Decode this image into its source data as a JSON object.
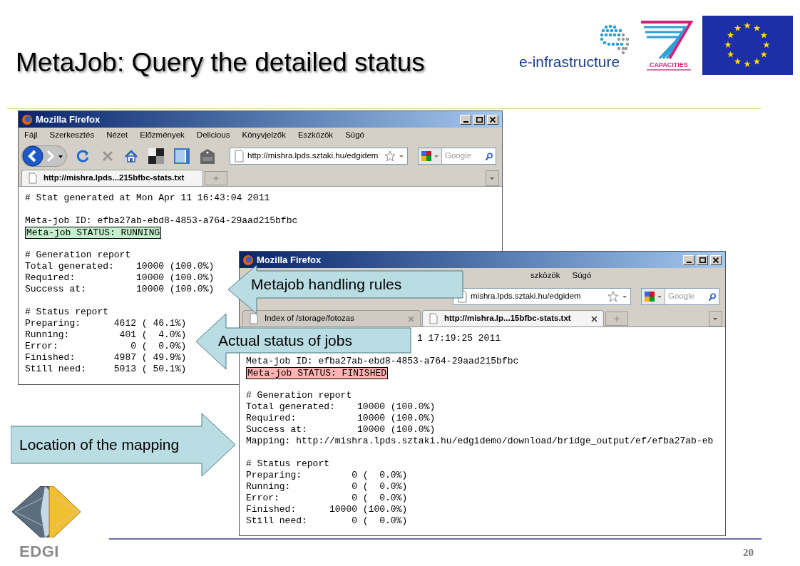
{
  "slide": {
    "title": "MetaJob: Query the detailed status",
    "page_number": "20"
  },
  "logos": {
    "einfra": "e-infrastructure",
    "fp7": "CAPACITIES",
    "edgi": "EDGI"
  },
  "windows": [
    {
      "title": "Mozilla Firefox",
      "toolbar_buttons": true,
      "menu": [
        "Fájl",
        "Szerkesztés",
        "Nézet",
        "Előzmények",
        "Delicious",
        "Könyvjelzők",
        "Eszközök",
        "Súgó"
      ],
      "url": "http://mishra.lpds.sztaki.hu/edgidem",
      "search_placeholder": "Google",
      "tabs": [
        {
          "label": "http://mishra.lpds...215bfbc-stats.txt",
          "selected": true,
          "close_button": false
        }
      ],
      "lines": [
        {
          "kind": "text",
          "text": "# Stat generated at Mon Apr 11 16:43:04 2011"
        },
        {
          "kind": "gap"
        },
        {
          "kind": "text",
          "text": "Meta-job ID: efba27ab-ebd8-4853-a764-29aad215bfbc"
        },
        {
          "kind": "status",
          "text": "Meta-job STATUS: RUNNING",
          "color": "#c6efce"
        },
        {
          "kind": "gap"
        },
        {
          "kind": "text",
          "text": "# Generation report"
        },
        {
          "kind": "text",
          "text": "Total generated:    10000 (100.0%)"
        },
        {
          "kind": "text",
          "text": "Required:           10000 (100.0%)"
        },
        {
          "kind": "text",
          "text": "Success at:         10000 (100.0%)"
        },
        {
          "kind": "gap"
        },
        {
          "kind": "text",
          "text": "# Status report"
        },
        {
          "kind": "text",
          "text": "Preparing:      4612 ( 46.1%)"
        },
        {
          "kind": "text",
          "text": "Running:         401 (  4.0%)"
        },
        {
          "kind": "text",
          "text": "Error:             0 (  0.0%)"
        },
        {
          "kind": "text",
          "text": "Finished:       4987 ( 49.9%)"
        },
        {
          "kind": "text",
          "text": "Still need:     5013 ( 50.1%)"
        }
      ]
    },
    {
      "title": "Mozilla Firefox",
      "toolbar_buttons": false,
      "menu": [
        "szközök",
        "Súgó"
      ],
      "url": "mishra.lpds.sztaki.hu/edgidem",
      "search_placeholder": "Google",
      "tabs": [
        {
          "label": "Index of /storage/fotozas",
          "selected": false,
          "close_button": true
        },
        {
          "label": "http://mishra.lp...15bfbc-stats.txt",
          "selected": true,
          "close_button": true
        }
      ],
      "lines": [
        {
          "kind": "cut",
          "text": "1 17:19:25 2011"
        },
        {
          "kind": "gap"
        },
        {
          "kind": "text",
          "text": "Meta-job ID: efba27ab-ebd8-4853-a764-29aad215bfbc"
        },
        {
          "kind": "status",
          "text": "Meta-job STATUS: FINISHED",
          "color": "#ffb3b3"
        },
        {
          "kind": "gap"
        },
        {
          "kind": "text",
          "text": "# Generation report"
        },
        {
          "kind": "text",
          "text": "Total generated:    10000 (100.0%)"
        },
        {
          "kind": "text",
          "text": "Required:           10000 (100.0%)"
        },
        {
          "kind": "text",
          "text": "Success at:         10000 (100.0%)"
        },
        {
          "kind": "text",
          "text": "Mapping: http://mishra.lpds.sztaki.hu/edgidemo/download/bridge_output/ef/efba27ab-eb"
        },
        {
          "kind": "gap"
        },
        {
          "kind": "text",
          "text": "# Status report"
        },
        {
          "kind": "text",
          "text": "Preparing:         0 (  0.0%)"
        },
        {
          "kind": "text",
          "text": "Running:           0 (  0.0%)"
        },
        {
          "kind": "text",
          "text": "Error:             0 (  0.0%)"
        },
        {
          "kind": "text",
          "text": "Finished:      10000 (100.0%)"
        },
        {
          "kind": "text",
          "text": "Still need:        0 (  0.0%)"
        }
      ]
    }
  ],
  "callouts": [
    {
      "text": "Metajob handling rules",
      "kind": "left"
    },
    {
      "text": "Actual status of jobs",
      "kind": "left"
    },
    {
      "text": "Location of the mapping",
      "kind": "right"
    }
  ]
}
